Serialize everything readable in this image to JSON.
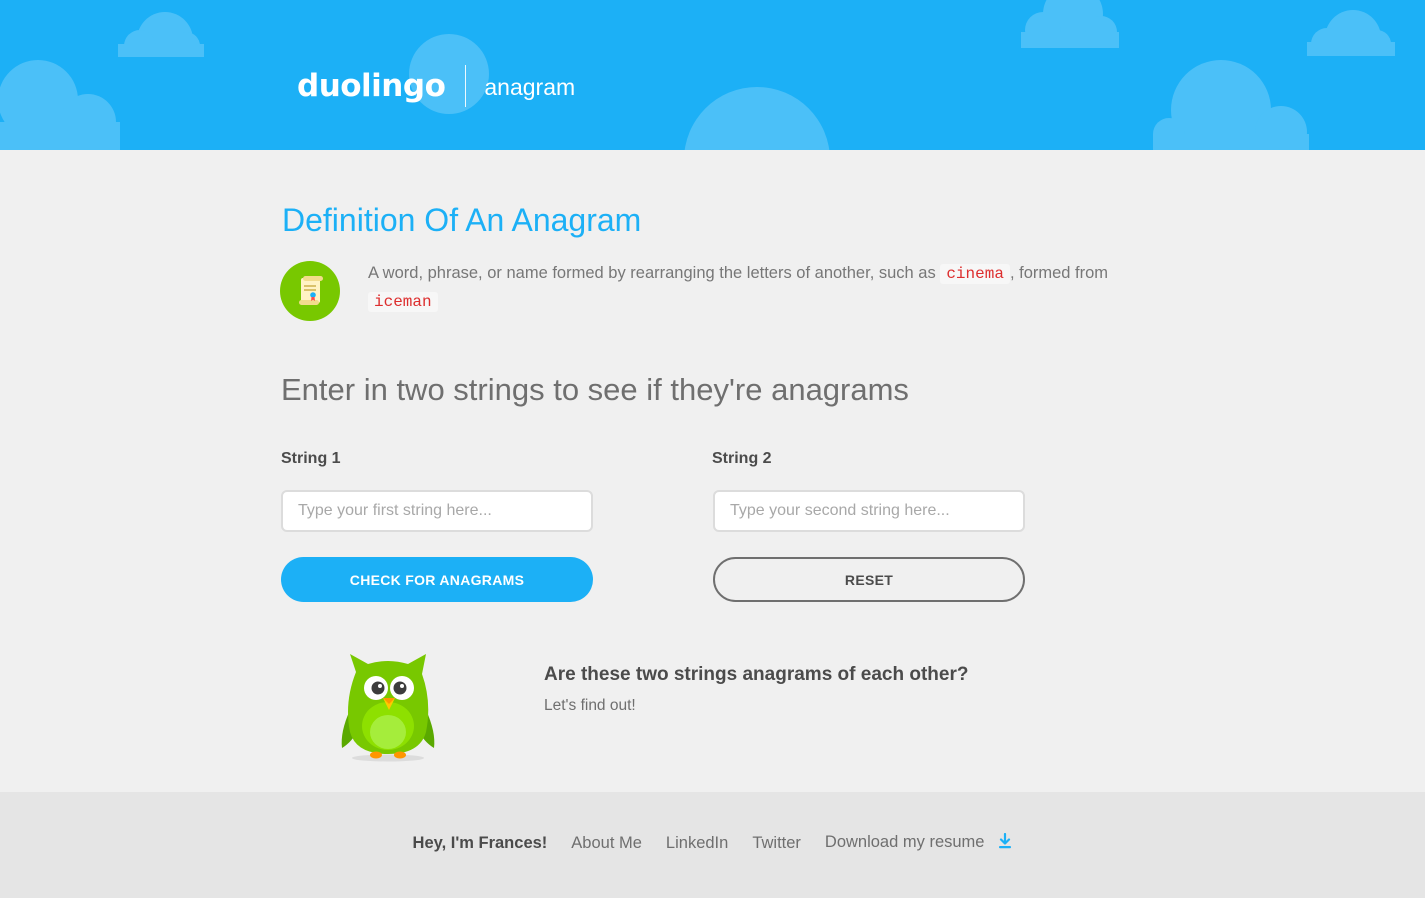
{
  "header": {
    "logo": "duolingo",
    "product": "anagram",
    "colors": {
      "sky": "#1cb0f6",
      "cloud": "#4bc0f8"
    }
  },
  "definition": {
    "title": "Definition Of An Anagram",
    "icon": "scroll-icon",
    "text_before": "A word, phrase, or name formed by rearranging the letters of another, such as",
    "example1": "cinema",
    "text_middle": ", formed from",
    "example2": "iceman"
  },
  "prompt": "Enter in two strings to see if they're anagrams",
  "form": {
    "string1_label": "String 1",
    "string1_placeholder": "Type your first string here...",
    "string1_value": "",
    "string2_label": "String 2",
    "string2_placeholder": "Type your second string here...",
    "string2_value": "",
    "check_button": "CHECK FOR ANAGRAMS",
    "reset_button": "RESET"
  },
  "result": {
    "mascot": "owl-mascot",
    "title": "Are these two strings anagrams of each other?",
    "subtitle": "Let's find out!"
  },
  "footer": {
    "greeting": "Hey, I'm Frances!",
    "links": [
      "About Me",
      "LinkedIn",
      "Twitter",
      "Download my resume"
    ],
    "download_icon": "download-icon"
  },
  "colors": {
    "accent": "#1cb0f6",
    "green": "#78c800",
    "code_red": "#dd2e2e"
  }
}
